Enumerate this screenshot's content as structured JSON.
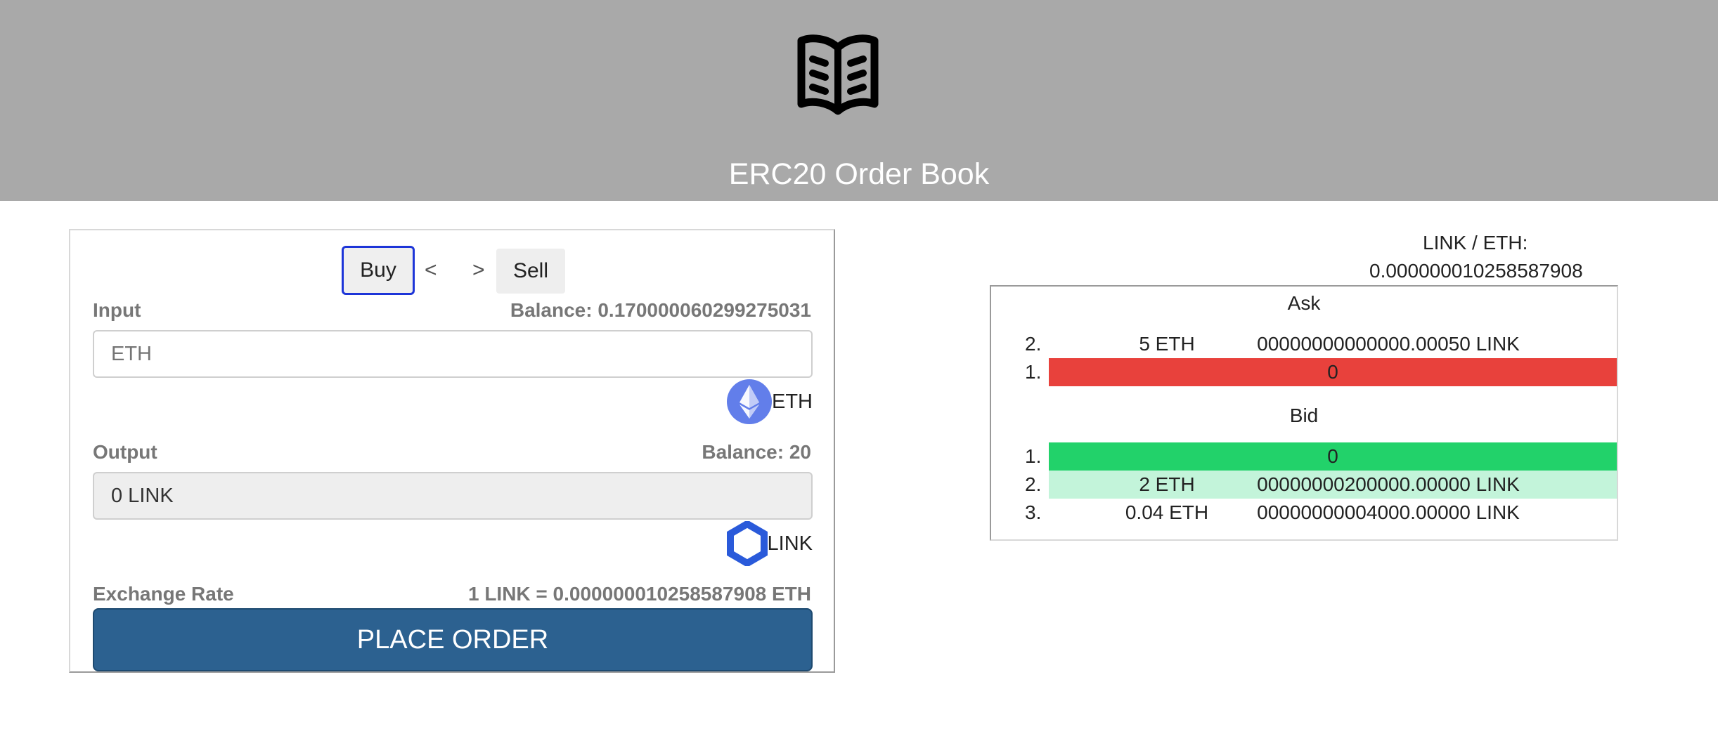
{
  "header": {
    "logo_icon": "open-book-icon",
    "title": "ERC20 Order Book"
  },
  "form": {
    "buy_label": "Buy",
    "sell_label": "Sell",
    "prev_label": "<",
    "next_label": ">",
    "input": {
      "label": "Input",
      "balance": "Balance:  0.170000060299275031",
      "placeholder": "ETH",
      "value": "",
      "token": "ETH",
      "token_icon": "ethereum-icon"
    },
    "output": {
      "label": "Output",
      "balance": "Balance: 20",
      "value": "0 LINK",
      "token": "LINK",
      "token_icon": "chainlink-icon"
    },
    "exchange_rate_label": "Exchange Rate",
    "exchange_rate_value": "1 LINK = 0.000000010258587908 ETH",
    "place_order_label": "PLACE ORDER"
  },
  "book": {
    "pair_label": "LINK / ETH:",
    "pair_price": "0.000000010258587908",
    "ask_heading": "Ask",
    "bid_heading": "Bid",
    "asks": [
      {
        "rank": "2.",
        "amount": "5 ETH",
        "total": "00000000000000.00050 LINK"
      },
      {
        "rank": "1.",
        "value": "0"
      }
    ],
    "bids": [
      {
        "rank": "1.",
        "value": "0"
      },
      {
        "rank": "2.",
        "amount": "2 ETH",
        "total": "00000000200000.00000 LINK"
      },
      {
        "rank": "3.",
        "amount": "0.04 ETH",
        "total": "00000000004000.00000 LINK"
      }
    ],
    "colors": {
      "ask_best": "#e8413c",
      "bid_best": "#22d26a",
      "bid_highlight": "#c3f4da"
    }
  }
}
